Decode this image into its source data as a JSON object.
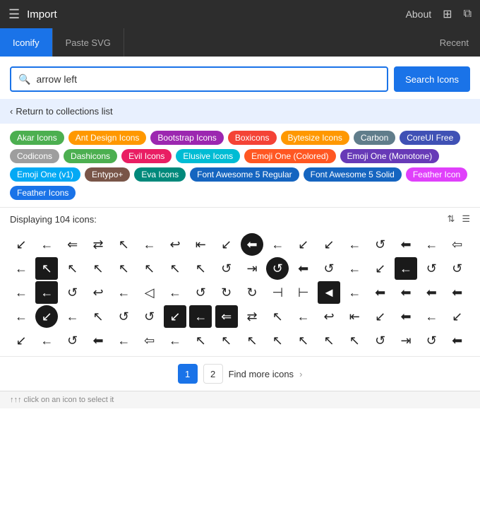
{
  "titlebar": {
    "title": "Import",
    "about": "About",
    "menu_icon": "☰",
    "grid_icon": "⊞",
    "window_icon": "⧉"
  },
  "tabs": {
    "tab1": "Iconify",
    "tab2": "Paste SVG",
    "recent": "Recent"
  },
  "search": {
    "placeholder": "arrow left",
    "value": "arrow left",
    "button": "Search Icons"
  },
  "return_link": "Return to collections list",
  "tags": [
    {
      "label": "Akar Icons",
      "color": "#4caf50"
    },
    {
      "label": "Ant Design Icons",
      "color": "#ff9800"
    },
    {
      "label": "Bootstrap Icons",
      "color": "#9c27b0"
    },
    {
      "label": "Boxicons",
      "color": "#f44336"
    },
    {
      "label": "Bytesize Icons",
      "color": "#ff9800"
    },
    {
      "label": "Carbon",
      "color": "#607d8b"
    },
    {
      "label": "CoreUI Free",
      "color": "#3f51b5"
    },
    {
      "label": "Codicons",
      "color": "#9e9e9e"
    },
    {
      "label": "Dashicons",
      "color": "#4caf50"
    },
    {
      "label": "Evil Icons",
      "color": "#e91e63"
    },
    {
      "label": "Elusive Icons",
      "color": "#00bcd4"
    },
    {
      "label": "Emoji One (Colored)",
      "color": "#ff5722"
    },
    {
      "label": "Emoji One (Monotone)",
      "color": "#673ab7"
    },
    {
      "label": "Emoji One (v1)",
      "color": "#03a9f4"
    },
    {
      "label": "Entypo+",
      "color": "#795548"
    },
    {
      "label": "Eva Icons",
      "color": "#00897b"
    },
    {
      "label": "Font Awesome 5 Regular",
      "color": "#1565c0"
    },
    {
      "label": "Font Awesome 5 Solid",
      "color": "#1565c0"
    },
    {
      "label": "Feather Icon",
      "color": "#e040fb"
    },
    {
      "label": "Feather Icons",
      "color": "#1a73e8"
    }
  ],
  "display_count": "Displaying 104 icons:",
  "pagination": {
    "page1": "1",
    "page2": "2",
    "find_more": "Find more icons"
  },
  "footer_hint": "↑↑↑ click on an icon to select it",
  "icons": [
    "↙",
    "←",
    "⇐",
    "⇄",
    "↖",
    "←",
    "↩",
    "⇤",
    "↙",
    "⊙",
    "⊛",
    "↙",
    "↙",
    "←",
    "⊙",
    "⊛",
    "←",
    "⇐",
    "⊙",
    "↖",
    "↖",
    "↖",
    "⊛",
    "↖",
    "↖",
    "↖",
    "⊙",
    "⇥",
    "⊙",
    "⊛",
    "⊙",
    "←",
    "↙",
    "←",
    "⊙",
    "⊙",
    "←",
    "←",
    "⊙",
    "↩",
    "←",
    "◁",
    "←",
    "⊙",
    "⊙",
    "⊙",
    "⇤",
    "⊣",
    "◄",
    "←",
    "⊛",
    "⊛",
    "⊛",
    "⊛",
    "←",
    "↙",
    "←",
    "↖",
    "⊙"
  ]
}
